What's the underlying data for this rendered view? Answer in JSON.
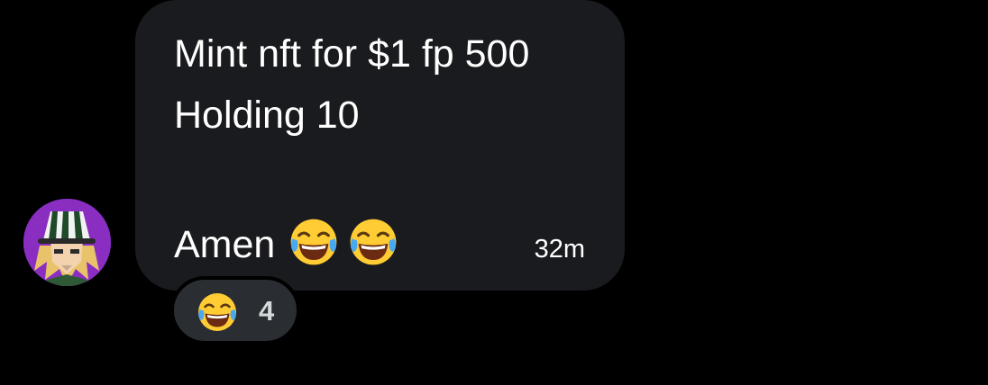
{
  "message": {
    "lines": [
      "Mint nft for $1 fp 500",
      "Holding 10",
      "Amen"
    ],
    "emojis": [
      "face-with-tears-of-joy",
      "face-with-tears-of-joy"
    ],
    "timestamp": "32m"
  },
  "reaction": {
    "emoji": "face-with-tears-of-joy",
    "count": "4"
  },
  "avatar": {
    "icon": "anime-character-avatar",
    "background": "#8a2ec2"
  },
  "colors": {
    "page_background": "#000000",
    "bubble_background": "#1a1b1e",
    "reaction_background": "#2a2d31",
    "text": "#ffffff"
  }
}
